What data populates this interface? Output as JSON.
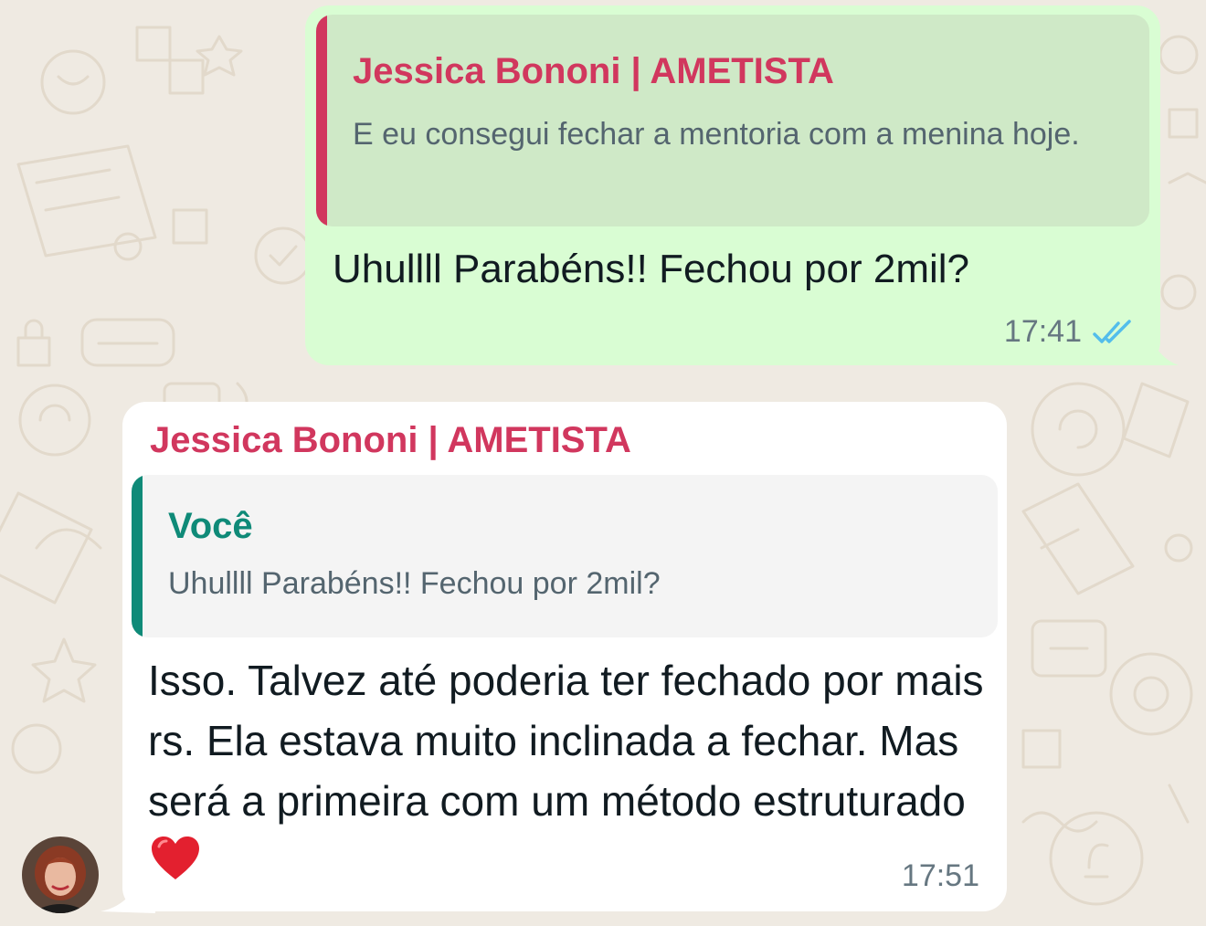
{
  "outgoing_message": {
    "quote": {
      "author": "Jessica Bononi | AMETISTA",
      "text": "E eu consegui fechar a mentoria com a menina hoje."
    },
    "text": "Uhullll Parabéns!! Fechou por 2mil?",
    "time": "17:41",
    "status_icon": "double-check-read-icon"
  },
  "incoming_message": {
    "sender": "Jessica Bononi | AMETISTA",
    "quote": {
      "author": "Você",
      "text": "Uhullll Parabéns!! Fechou por 2mil?"
    },
    "text": "Isso. Talvez até poderia ter fechado por mais rs. Ela estava muito inclinada a fechar. Mas será a primeira com um método estruturado",
    "emoji": "heart-emoji",
    "time": "17:51"
  },
  "colors": {
    "chat_background": "#efeae2",
    "outgoing_bubble": "#d9fdd3",
    "incoming_bubble": "#ffffff",
    "sender_name": "#d1375e",
    "own_name": "#0f8a78",
    "read_ticks": "#53bdeb",
    "secondary_text": "#667781"
  }
}
